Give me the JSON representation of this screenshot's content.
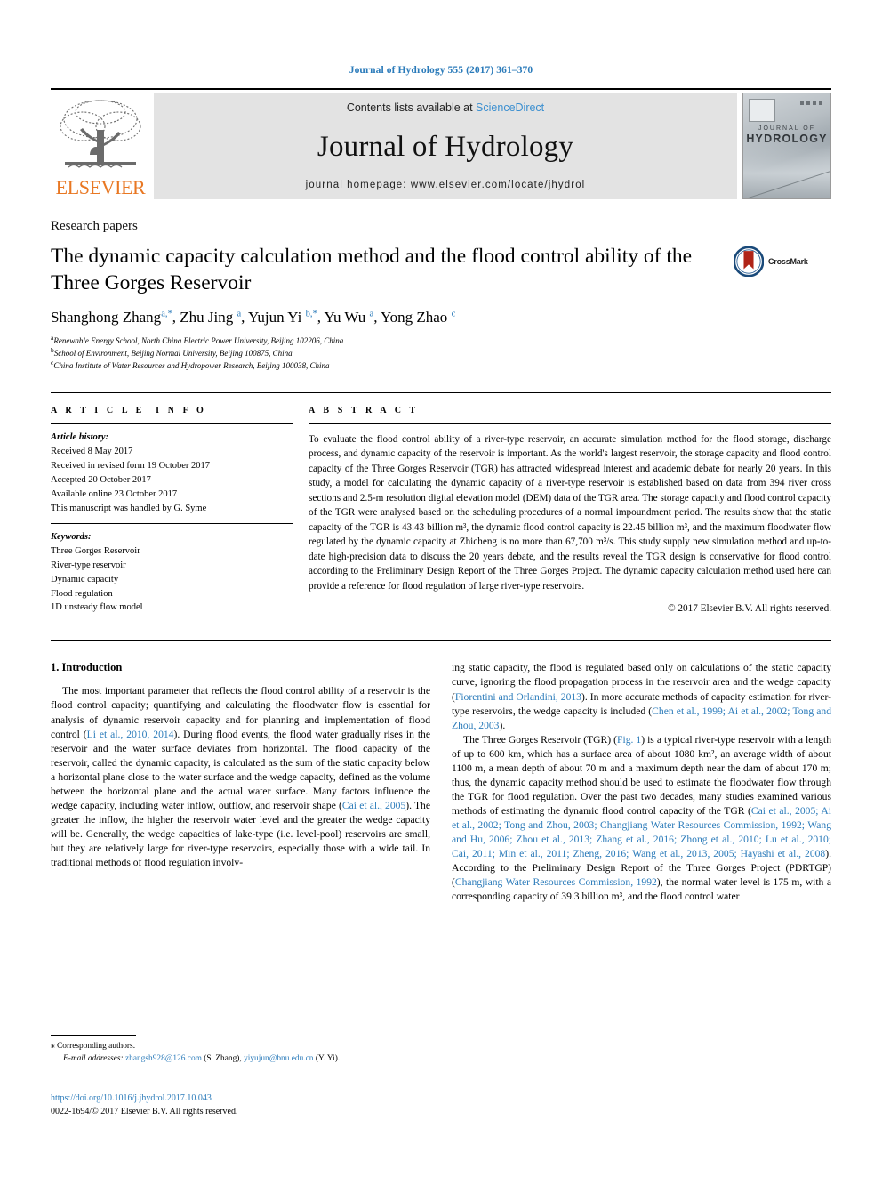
{
  "running_head": "Journal of Hydrology 555 (2017) 361–370",
  "masthead": {
    "contents_prefix": "Contents lists available at ",
    "sciencedirect": "ScienceDirect",
    "journal_title": "Journal of Hydrology",
    "homepage": "journal homepage: www.elsevier.com/locate/jhydrol",
    "publisher_logo_text": "ELSEVIER",
    "cover_line1": "JOURNAL OF",
    "cover_line2": "HYDROLOGY",
    "accent_orange": "#e87722",
    "accent_blue": "#2b7bba"
  },
  "article": {
    "section_label": "Research papers",
    "title": "The dynamic capacity calculation method and the flood control ability of the Three Gorges Reservoir",
    "crossmark_label": "CrossMark",
    "authors_html": "Shanghong Zhang<sup>a,*</sup>, Zhu Jing <sup>a</sup>, Yujun Yi <sup>b,*</sup>, Yu Wu <sup>a</sup>, Yong Zhao <sup>c</sup>",
    "affiliations": [
      {
        "mark": "a",
        "text": "Renewable Energy School, North China Electric Power University, Beijing 102206, China"
      },
      {
        "mark": "b",
        "text": "School of Environment, Beijing Normal University, Beijing 100875, China"
      },
      {
        "mark": "c",
        "text": "China Institute of Water Resources and Hydropower Research, Beijing 100038, China"
      }
    ]
  },
  "article_info": {
    "heading": "ARTICLE INFO",
    "history_label": "Article history:",
    "history": [
      "Received 8 May 2017",
      "Received in revised form 19 October 2017",
      "Accepted 20 October 2017",
      "Available online 23 October 2017",
      "This manuscript was handled by G. Syme"
    ],
    "keywords_label": "Keywords:",
    "keywords": [
      "Three Gorges Reservoir",
      "River-type reservoir",
      "Dynamic capacity",
      "Flood regulation",
      "1D unsteady flow model"
    ]
  },
  "abstract": {
    "heading": "ABSTRACT",
    "body": "To evaluate the flood control ability of a river-type reservoir, an accurate simulation method for the flood storage, discharge process, and dynamic capacity of the reservoir is important. As the world's largest reservoir, the storage capacity and flood control capacity of the Three Gorges Reservoir (TGR) has attracted widespread interest and academic debate for nearly 20 years. In this study, a model for calculating the dynamic capacity of a river-type reservoir is established based on data from 394 river cross sections and 2.5-m resolution digital elevation model (DEM) data of the TGR area. The storage capacity and flood control capacity of the TGR were analysed based on the scheduling procedures of a normal impoundment period. The results show that the static capacity of the TGR is 43.43 billion m³, the dynamic flood control capacity is 22.45 billion m³, and the maximum floodwater flow regulated by the dynamic capacity at Zhicheng is no more than 67,700 m³/s. This study supply new simulation method and up-to-date high-precision data to discuss the 20 years debate, and the results reveal the TGR design is conservative for flood control according to the Preliminary Design Report of the Three Gorges Project. The dynamic capacity calculation method used here can provide a reference for flood regulation of large river-type reservoirs.",
    "copyright": "© 2017 Elsevier B.V. All rights reserved."
  },
  "introduction": {
    "heading": "1. Introduction",
    "left_p1_a": "The most important parameter that reflects the flood control ability of a reservoir is the flood control capacity; quantifying and calculating the floodwater flow is essential for analysis of dynamic reservoir capacity and for planning and implementation of flood control (",
    "left_p1_ref1": "Li et al., 2010, 2014",
    "left_p1_b": "). During flood events, the flood water gradually rises in the reservoir and the water surface deviates from horizontal. The flood capacity of the reservoir, called the dynamic capacity, is calculated as the sum of the static capacity below a horizontal plane close to the water surface and the wedge capacity, defined as the volume between the horizontal plane and the actual water surface. Many factors influence the wedge capacity, including water inflow, outflow, and reservoir shape (",
    "left_p1_ref2": "Cai et al., 2005",
    "left_p1_c": "). The greater the inflow, the higher the reservoir water level and the greater the wedge capacity will be. Generally, the wedge capacities of lake-type (i.e. level-pool) reservoirs are small, but they are relatively large for river-type reservoirs, especially those with a wide tail. In traditional methods of flood regulation involv-",
    "right_p1_a": "ing static capacity, the flood is regulated based only on calculations of the static capacity curve, ignoring the flood propagation process in the reservoir area and the wedge capacity (",
    "right_p1_ref1": "Fiorentini and Orlandini, 2013",
    "right_p1_b": "). In more accurate methods of capacity estimation for river-type reservoirs, the wedge capacity is included (",
    "right_p1_ref2": "Chen et al., 1999; Ai et al., 2002; Tong and Zhou, 2003",
    "right_p1_c": ").",
    "right_p2_a": "The Three Gorges Reservoir (TGR) (",
    "right_p2_figref": "Fig. 1",
    "right_p2_b": ") is a typical river-type reservoir with a length of up to 600 km, which has a surface area of about 1080 km², an average width of about 1100 m, a mean depth of about 70 m and a maximum depth near the dam of about 170 m; thus, the dynamic capacity method should be used to estimate the floodwater flow through the TGR for flood regulation. Over the past two decades, many studies examined various methods of estimating the dynamic flood control capacity of the TGR (",
    "right_p2_ref1": "Cai et al., 2005; Ai et al., 2002; Tong and Zhou, 2003; Changjiang Water Resources Commission, 1992; Wang and Hu, 2006; Zhou et al., 2013; Zhang et al., 2016; Zhong et al., 2010; Lu et al., 2010; Cai, 2011; Min et al., 2011; Zheng, 2016; Wang et al., 2013, 2005; Hayashi et al., 2008",
    "right_p2_c": "). According to the Preliminary Design Report of the Three Gorges Project (PDRTGP) (",
    "right_p2_ref2": "Changjiang Water Resources Commission, 1992",
    "right_p2_d": "), the normal water level is 175 m, with a corresponding capacity of 39.3 billion m³, and the flood control water"
  },
  "footnote": {
    "corresponding_mark": "⁎",
    "corresponding_text": "Corresponding authors.",
    "email_label": "E-mail addresses:",
    "email1": "zhangsh928@126.com",
    "email1_owner": "(S. Zhang),",
    "email2": "yiyujun@bnu.edu.cn",
    "email2_owner": "(Y. Yi)."
  },
  "doi_block": {
    "doi": "https://doi.org/10.1016/j.jhydrol.2017.10.043",
    "issn_line": "0022-1694/© 2017 Elsevier B.V. All rights reserved."
  }
}
